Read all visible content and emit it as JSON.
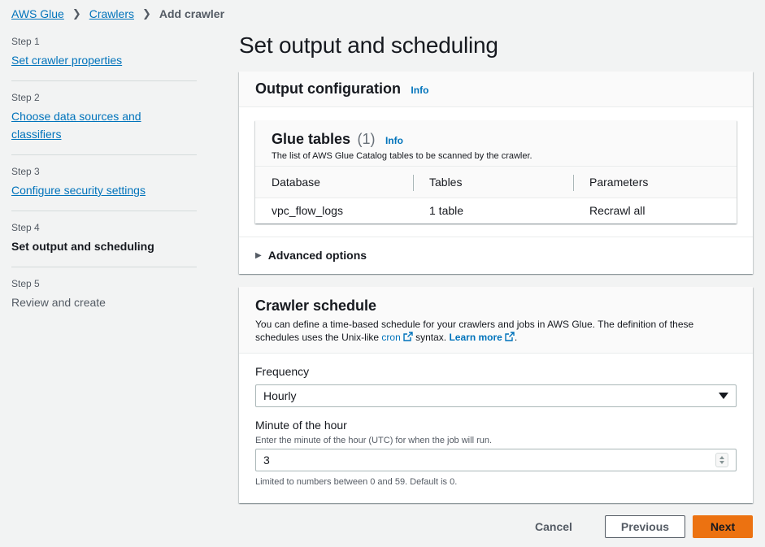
{
  "breadcrumb": {
    "items": [
      "AWS Glue",
      "Crawlers"
    ],
    "current": "Add crawler"
  },
  "steps": [
    {
      "num": "Step 1",
      "label": "Set crawler properties",
      "state": "link"
    },
    {
      "num": "Step 2",
      "label": "Choose data sources and classifiers",
      "state": "link"
    },
    {
      "num": "Step 3",
      "label": "Configure security settings",
      "state": "link"
    },
    {
      "num": "Step 4",
      "label": "Set output and scheduling",
      "state": "current"
    },
    {
      "num": "Step 5",
      "label": "Review and create",
      "state": "disabled"
    }
  ],
  "page_title": "Set output and scheduling",
  "output_config": {
    "title": "Output configuration",
    "info": "Info",
    "glue_tables": {
      "title": "Glue tables",
      "count": "(1)",
      "info": "Info",
      "description": "The list of AWS Glue Catalog tables to be scanned by the crawler.",
      "columns": [
        "Database",
        "Tables",
        "Parameters"
      ],
      "rows": [
        [
          "vpc_flow_logs",
          "1 table",
          "Recrawl all"
        ]
      ]
    },
    "advanced_options": "Advanced options"
  },
  "schedule": {
    "title": "Crawler schedule",
    "desc_part1": "You can define a time-based schedule for your crawlers and jobs in AWS Glue. The definition of these schedules uses the Unix-like",
    "cron_link": "cron",
    "desc_part2": "syntax.",
    "learn_more": "Learn more",
    "frequency_label": "Frequency",
    "frequency_value": "Hourly",
    "minute_label": "Minute of the hour",
    "minute_desc": "Enter the minute of the hour (UTC) for when the job will run.",
    "minute_value": "3",
    "minute_constraint": "Limited to numbers between 0 and 59. Default is 0."
  },
  "actions": {
    "cancel": "Cancel",
    "previous": "Previous",
    "next": "Next"
  },
  "colors": {
    "link": "#0073bb",
    "primary_button": "#ec7211",
    "background": "#f2f3f3"
  }
}
